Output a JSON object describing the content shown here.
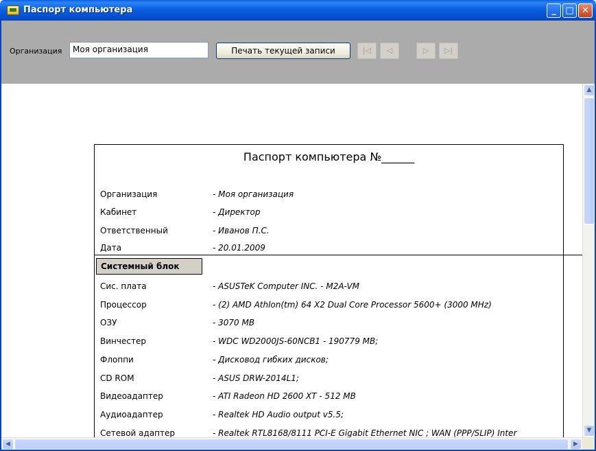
{
  "window": {
    "title": "Паспорт компьютера"
  },
  "toolbar": {
    "org_label": "Организация",
    "org_value": "Моя организация",
    "print_label": "Печать текущей записи",
    "nav": [
      "|◁",
      "◁",
      "▷",
      "▷|"
    ]
  },
  "report": {
    "title": "Паспорт компьютера №______",
    "header_rows": [
      {
        "label": "Организация",
        "value": "- Моя организация"
      },
      {
        "label": "Кабинет",
        "value": "- Директор"
      },
      {
        "label": "Ответственный",
        "value": "- Иванов П.С."
      },
      {
        "label": "Дата",
        "value": "- 20.01.2009"
      }
    ],
    "section": "Системный блок",
    "rows": [
      {
        "label": "Сис. плата",
        "value": "- ASUSTeK Computer INC. -  M2A-VM"
      },
      {
        "label": "Процессор",
        "value": "- (2) AMD Athlon(tm) 64 X2 Dual Core Processor 5600+ (3000 MHz)"
      },
      {
        "label": "ОЗУ",
        "value": "- 3070 MB"
      },
      {
        "label": "Винчестер",
        "value": "- WDC WD2000JS-60NCB1 - 190779 MB;"
      },
      {
        "label": "Флоппи",
        "value": "- Дисковод гибких дисков;"
      },
      {
        "label": "CD ROM",
        "value": "- ASUS DRW-2014L1;"
      },
      {
        "label": "Видеоадаптер",
        "value": "- ATI Radeon HD 2600 XT - 512 MB"
      },
      {
        "label": "Аудиоадаптер",
        "value": "- Realtek HD Audio output v5.5;"
      },
      {
        "label": "Сетевой адаптер",
        "value": "- Realtek RTL8168/8111 PCI-E Gigabit Ethernet NIC ; WAN (PPP/SLIP) Inter"
      }
    ]
  }
}
